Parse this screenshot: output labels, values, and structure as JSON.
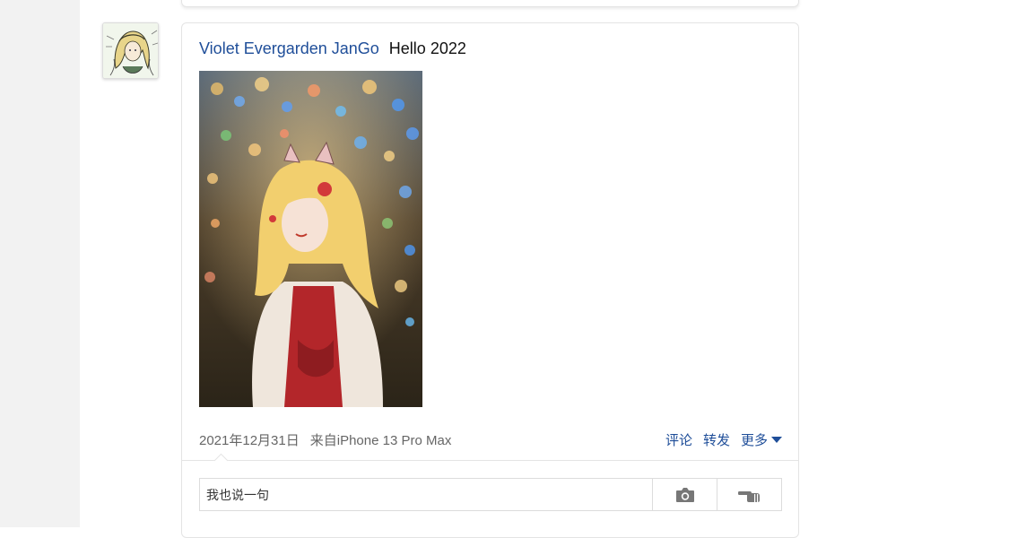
{
  "post": {
    "author": "Violet Evergarden JanGo",
    "text": "Hello 2022",
    "date": "2021年12月31日",
    "source": "来自iPhone 13 Pro Max"
  },
  "actions": {
    "comment": "评论",
    "repost": "转发",
    "more": "更多"
  },
  "comment": {
    "placeholder": "我也说一句"
  },
  "icons": {
    "camera": "camera-icon",
    "hand": "pointing-hand-icon",
    "more": "caret-down-icon"
  },
  "colors": {
    "link": "#1f4e99",
    "meta": "#666666",
    "border": "#e4e4e4",
    "gutter": "#f2f2f2"
  }
}
